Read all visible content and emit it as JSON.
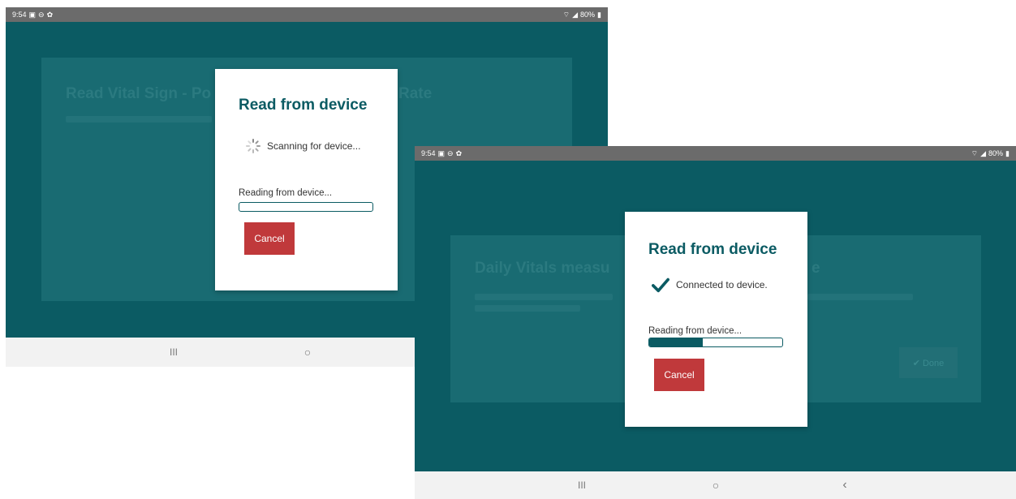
{
  "screens": [
    {
      "status_bar": {
        "time": "9:54",
        "battery": "80%"
      },
      "background": {
        "title": "Read Vital Sign - Po",
        "title_tail": "Rate"
      },
      "dialog": {
        "title": "Read from device",
        "status_text": "Scanning for device...",
        "status_icon": "spinner-icon",
        "reading_label": "Reading from device...",
        "progress": 0,
        "cancel_label": "Cancel"
      },
      "nav": {
        "recent": "III",
        "home": "○"
      }
    },
    {
      "status_bar": {
        "time": "9:54",
        "battery": "80%"
      },
      "background": {
        "title": "Daily Vitals measu",
        "title_tail": "e",
        "done_label": "✔ Done"
      },
      "dialog": {
        "title": "Read from device",
        "status_text": "Connected to device.",
        "status_icon": "checkmark-icon",
        "reading_label": "Reading from device...",
        "progress": 0.4,
        "cancel_label": "Cancel"
      },
      "nav": {
        "recent": "III",
        "home": "○",
        "back": "‹"
      }
    }
  ],
  "colors": {
    "teal": "#0b5b63",
    "cancel": "#c0393b",
    "statusbar": "#6b6b6b"
  }
}
